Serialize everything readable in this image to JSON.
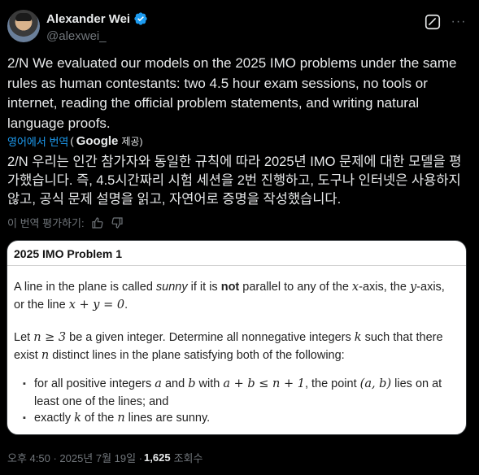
{
  "author": {
    "name": "Alexander Wei",
    "handle": "@alexwei_"
  },
  "tweet": {
    "text": "2/N We evaluated our models on the 2025 IMO problems under the same rules as human contestants: two 4.5 hour exam sessions, no tools or internet, reading the official problem statements, and writing natural language proofs.",
    "translated_from": "영어에서 번역",
    "translated_by_open": "(",
    "translated_by_brand": "Google",
    "translated_by_close": "제공)",
    "translated_text": "2/N 우리는 인간 참가자와 동일한 규칙에 따라 2025년 IMO 문제에 대한 모델을 평가했습니다. 즉, 4.5시간짜리 시험 세션을 2번 진행하고, 도구나 인터넷은 사용하지 않고, 공식 문제 설명을 읽고, 자연어로 증명을 작성했습니다.",
    "rate_label": "이 번역 평가하기:"
  },
  "card": {
    "title": "2025 IMO Problem 1",
    "p1_a": "A line in the plane is called ",
    "p1_sunny": "sunny",
    "p1_b": " if it is ",
    "p1_not": "not",
    "p1_c": " parallel to any of the ",
    "p1_x": "x",
    "p1_d": "-axis, the ",
    "p1_y": "y",
    "p1_e": "-axis, or the line ",
    "p1_eq": "x + y = 0",
    "p1_f": ".",
    "p2_a": "Let ",
    "p2_n": "n ≥ 3",
    "p2_b": " be a given integer. Determine all nonnegative integers ",
    "p2_k": "k",
    "p2_c": " such that there exist ",
    "p2_n2": "n",
    "p2_d": " distinct lines in the plane satisfying both of the following:",
    "b1_a": "for all positive integers ",
    "b1_av": "a",
    "b1_b": " and ",
    "b1_bv": "b",
    "b1_c": " with ",
    "b1_ineq": "a + b ≤ n + 1",
    "b1_d": ", the point ",
    "b1_pt": "(a, b)",
    "b1_e": " lies on at least one of the lines; and",
    "b2_a": "exactly ",
    "b2_k": "k",
    "b2_b": " of the ",
    "b2_n": "n",
    "b2_c": " lines are sunny."
  },
  "footer": {
    "time": "오후 4:50 · 2025년 7월 19일 ·",
    "views": "1,625",
    "views_label": "조회수"
  },
  "colors": {
    "background": "#000000",
    "accent": "#1d9bf0",
    "muted": "#71767b",
    "text": "#e7e9ea"
  },
  "icons": [
    "verified-badge-icon",
    "grok-icon",
    "more-icon",
    "thumbs-up-icon",
    "thumbs-down-icon"
  ]
}
